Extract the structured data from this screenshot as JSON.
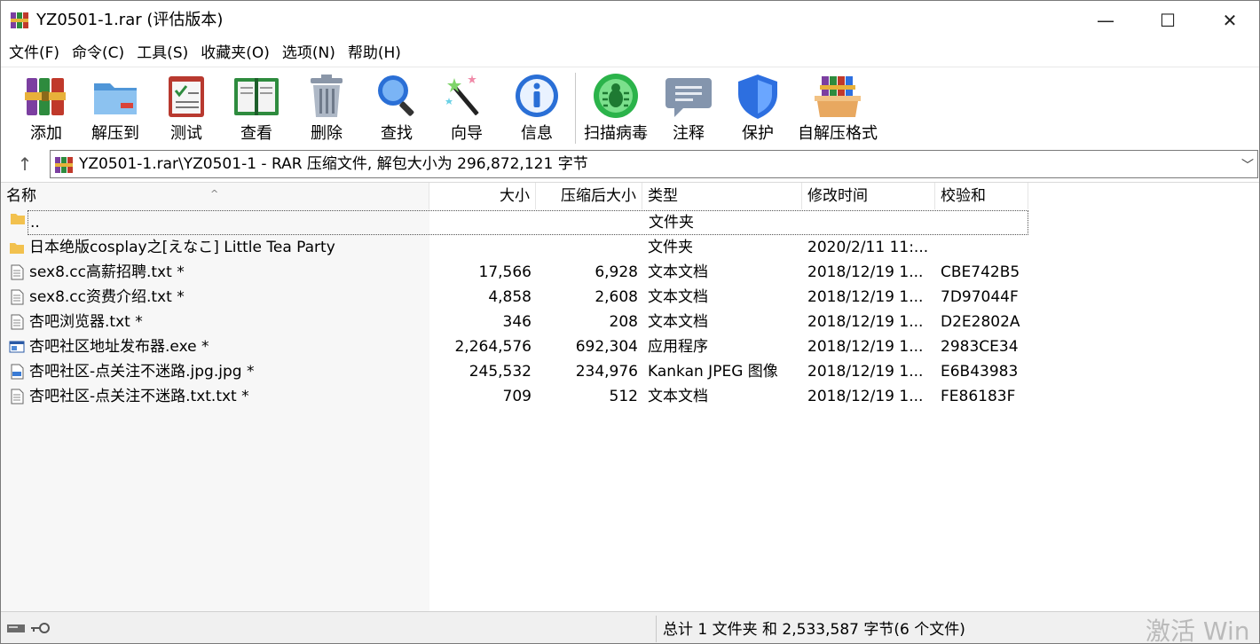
{
  "window": {
    "title": "YZ0501-1.rar (评估版本)",
    "min_symbol": "—",
    "max_symbol": "☐",
    "close_symbol": "✕"
  },
  "menu": [
    "文件(F)",
    "命令(C)",
    "工具(S)",
    "收藏夹(O)",
    "选项(N)",
    "帮助(H)"
  ],
  "toolbar": [
    {
      "label": "添加",
      "icon": "add-archive-icon"
    },
    {
      "label": "解压到",
      "icon": "extract-folder-icon"
    },
    {
      "label": "测试",
      "icon": "test-clipboard-icon"
    },
    {
      "label": "查看",
      "icon": "view-book-icon"
    },
    {
      "label": "删除",
      "icon": "trash-icon"
    },
    {
      "label": "查找",
      "icon": "magnifier-icon"
    },
    {
      "label": "向导",
      "icon": "wizard-wand-icon"
    },
    {
      "label": "信息",
      "icon": "info-icon"
    },
    {
      "label": "扫描病毒",
      "icon": "virus-scan-icon"
    },
    {
      "label": "注释",
      "icon": "comment-icon"
    },
    {
      "label": "保护",
      "icon": "shield-icon"
    },
    {
      "label": "自解压格式",
      "icon": "sfx-box-icon"
    }
  ],
  "address": {
    "up_symbol": "↑",
    "path_text": "YZ0501-1.rar\\YZ0501-1 - RAR 压缩文件, 解包大小为 296,872,121 字节",
    "dropdown_symbol": "﹀"
  },
  "columns": {
    "name": "名称",
    "size": "大小",
    "packed": "压缩后大小",
    "type": "类型",
    "mtime": "修改时间",
    "crc": "校验和",
    "sort_symbol": "^"
  },
  "files": [
    {
      "icon": "folder-up-icon",
      "name": "..",
      "size": "",
      "packed": "",
      "type": "文件夹",
      "mtime": "",
      "crc": ""
    },
    {
      "icon": "folder-icon",
      "name": "日本绝版cosplay之[えなこ] Little Tea Party",
      "size": "",
      "packed": "",
      "type": "文件夹",
      "mtime": "2020/2/11 11:...",
      "crc": ""
    },
    {
      "icon": "text-file-icon",
      "name": "sex8.cc高薪招聘.txt *",
      "size": "17,566",
      "packed": "6,928",
      "type": "文本文档",
      "mtime": "2018/12/19 1...",
      "crc": "CBE742B5"
    },
    {
      "icon": "text-file-icon",
      "name": "sex8.cc资费介绍.txt *",
      "size": "4,858",
      "packed": "2,608",
      "type": "文本文档",
      "mtime": "2018/12/19 1...",
      "crc": "7D97044F"
    },
    {
      "icon": "text-file-icon",
      "name": "杏吧浏览器.txt *",
      "size": "346",
      "packed": "208",
      "type": "文本文档",
      "mtime": "2018/12/19 1...",
      "crc": "D2E2802A"
    },
    {
      "icon": "exe-file-icon",
      "name": "杏吧社区地址发布器.exe *",
      "size": "2,264,576",
      "packed": "692,304",
      "type": "应用程序",
      "mtime": "2018/12/19 1...",
      "crc": "2983CE34"
    },
    {
      "icon": "jpeg-file-icon",
      "name": "杏吧社区-点关注不迷路.jpg.jpg *",
      "size": "245,532",
      "packed": "234,976",
      "type": "Kankan JPEG 图像",
      "mtime": "2018/12/19 1...",
      "crc": "E6B43983"
    },
    {
      "icon": "text-file-icon",
      "name": "杏吧社区-点关注不迷路.txt.txt *",
      "size": "709",
      "packed": "512",
      "type": "文本文档",
      "mtime": "2018/12/19 1...",
      "crc": "FE86183F"
    }
  ],
  "status": {
    "summary": "总计 1 文件夹 和 2,533,587 字节(6 个文件)",
    "watermark": "激活 Win"
  },
  "colors": {
    "folder": "#f2c14e",
    "info_blue": "#2a6fd6",
    "virus_green": "#2bb34a",
    "shield_blue": "#2d6fe0"
  }
}
